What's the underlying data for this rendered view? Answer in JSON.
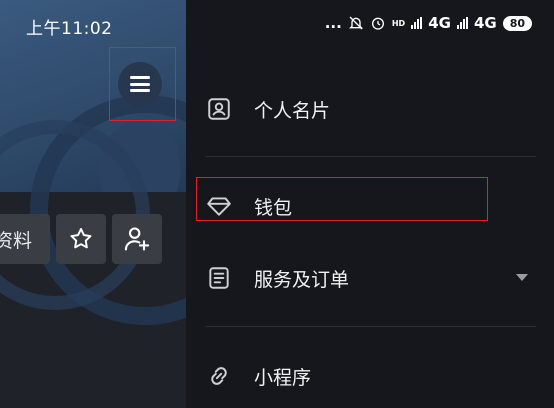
{
  "status_bar": {
    "time": "上午11:02",
    "dots": "...",
    "network1": "4G",
    "network2": "4G",
    "hd_label": "HD",
    "battery": "80"
  },
  "profile": {
    "edit_profile_label": "资料"
  },
  "drawer": {
    "items": [
      {
        "label": "个人名片",
        "icon": "id-card-icon"
      },
      {
        "label": "钱包",
        "icon": "diamond-icon"
      },
      {
        "label": "服务及订单",
        "icon": "document-icon"
      },
      {
        "label": "小程序",
        "icon": "link-icon"
      }
    ]
  },
  "colors": {
    "highlight": "#e0202a",
    "drawer_bg": "#15171c",
    "button_bg": "#3a3d44",
    "cover_blue": "#2f4a6b"
  }
}
